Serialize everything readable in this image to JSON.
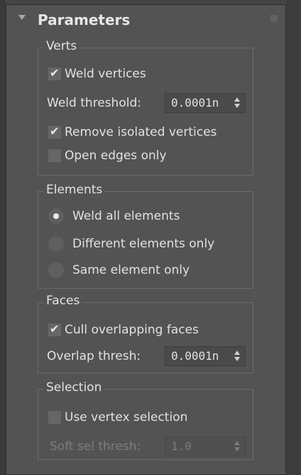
{
  "rollout": {
    "title": "Parameters"
  },
  "verts": {
    "title": "Verts",
    "weld_vertices": {
      "label": "Weld vertices",
      "checked": true
    },
    "weld_threshold": {
      "label": "Weld threshold:",
      "value": "0.0001n"
    },
    "remove_isolated": {
      "label": "Remove isolated vertices",
      "checked": true
    },
    "open_edges_only": {
      "label": "Open edges only",
      "checked": false
    }
  },
  "elements": {
    "title": "Elements",
    "options": [
      {
        "label": "Weld all elements",
        "selected": true
      },
      {
        "label": "Different elements only",
        "selected": false
      },
      {
        "label": "Same element only",
        "selected": false
      }
    ]
  },
  "faces": {
    "title": "Faces",
    "cull_overlapping": {
      "label": "Cull overlapping faces",
      "checked": true
    },
    "overlap_thresh": {
      "label": "Overlap thresh:",
      "value": "0.0001n"
    }
  },
  "selection": {
    "title": "Selection",
    "use_vertex_selection": {
      "label": "Use vertex selection",
      "checked": false
    },
    "soft_sel_thresh": {
      "label": "Soft sel thresh:",
      "value": "1.0",
      "enabled": false
    }
  },
  "icons": {
    "collapse": "triangle-down-icon",
    "grip": "grip-dots-icon",
    "check": "checkmark-icon"
  },
  "colors": {
    "panel_bg": "#535353",
    "group_border": "#6b6b6b",
    "text": "#e2e2e2",
    "disabled_text": "#7d7d7d"
  }
}
